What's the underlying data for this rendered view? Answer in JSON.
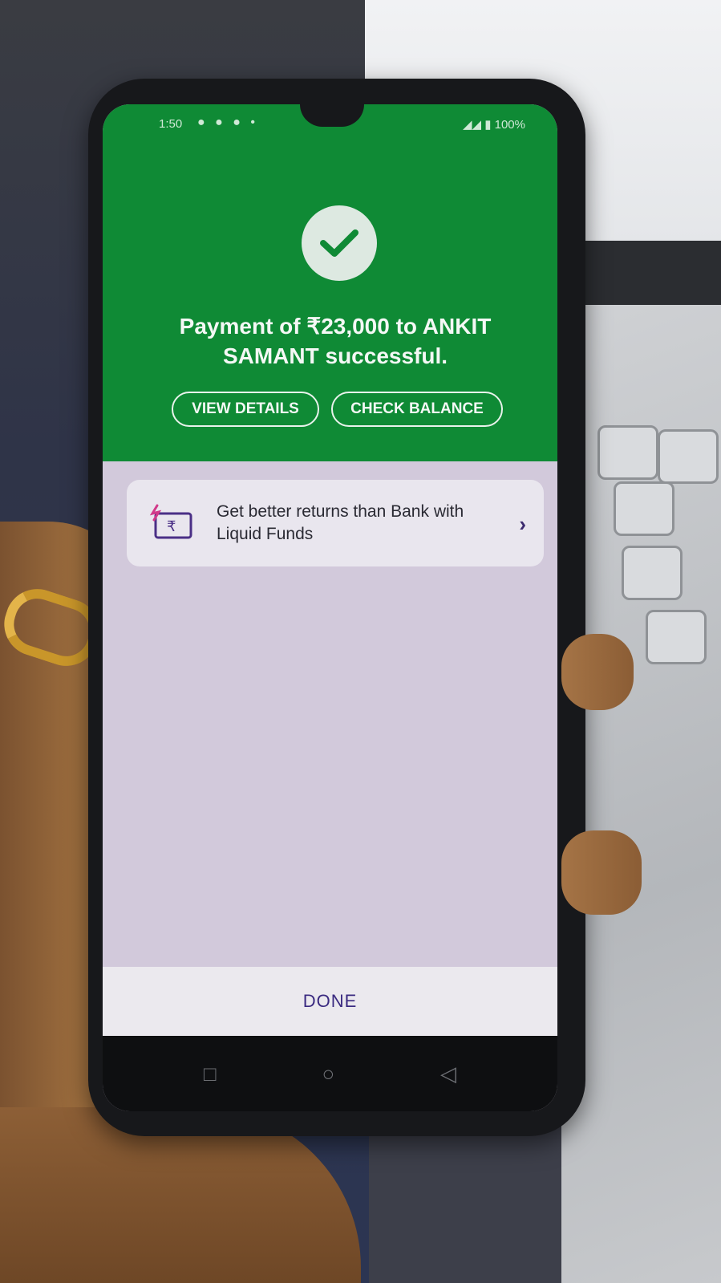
{
  "status_bar": {
    "time": "1:50",
    "notification_icons": "● ● ● •",
    "battery": "100%"
  },
  "success": {
    "message": "Payment of ₹23,000 to ANKIT SAMANT successful.",
    "view_details_label": "VIEW DETAILS",
    "check_balance_label": "CHECK BALANCE"
  },
  "promo": {
    "text": "Get better returns than Bank with Liquid Funds",
    "chevron": "›"
  },
  "footer": {
    "done_label": "DONE"
  },
  "nav": {
    "recent_icon": "□",
    "home_icon": "○",
    "back_icon": "◁"
  },
  "colors": {
    "success_green": "#0f8a35",
    "screen_background": "#d2c9db",
    "accent_purple": "#3a2a80"
  },
  "icons": [
    "check-icon",
    "rupee-card-icon",
    "chevron-right-icon",
    "recent-apps-icon",
    "home-icon",
    "back-icon"
  ]
}
